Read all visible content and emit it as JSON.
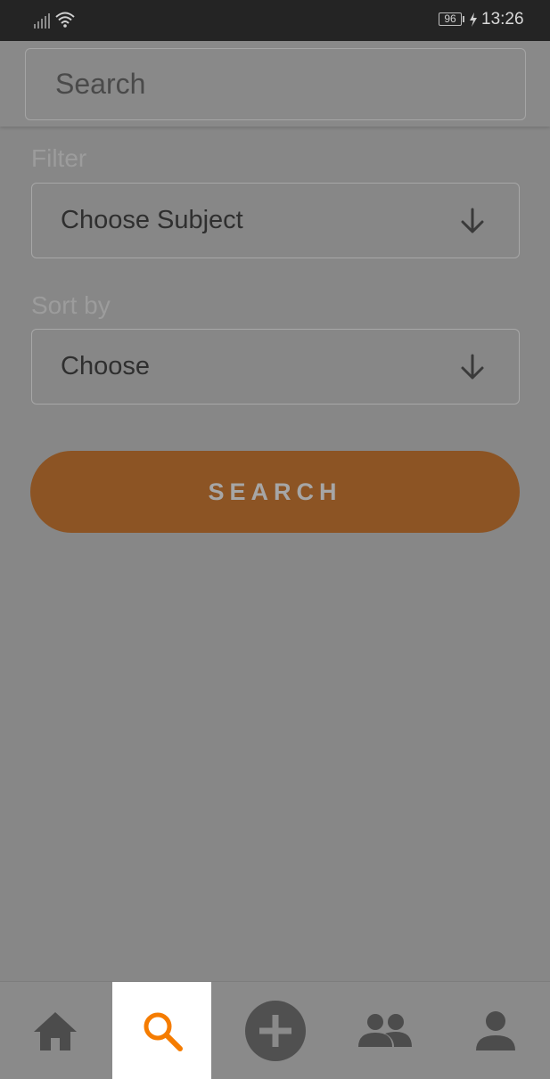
{
  "status_bar": {
    "battery_level": "96",
    "time": "13:26"
  },
  "search": {
    "placeholder": "Search"
  },
  "filter": {
    "label": "Filter",
    "selected": "Choose Subject"
  },
  "sort": {
    "label": "Sort by",
    "selected": "Choose"
  },
  "actions": {
    "search_button": "SEARCH"
  },
  "bottom_nav": {
    "items": [
      {
        "icon": "home-icon",
        "active": false
      },
      {
        "icon": "search-icon",
        "active": true
      },
      {
        "icon": "add-circle-icon",
        "active": false
      },
      {
        "icon": "people-icon",
        "active": false
      },
      {
        "icon": "person-icon",
        "active": false
      }
    ]
  },
  "colors": {
    "accent": "#f57c00",
    "button": "#8c5424",
    "overlay_background": "#878787"
  }
}
